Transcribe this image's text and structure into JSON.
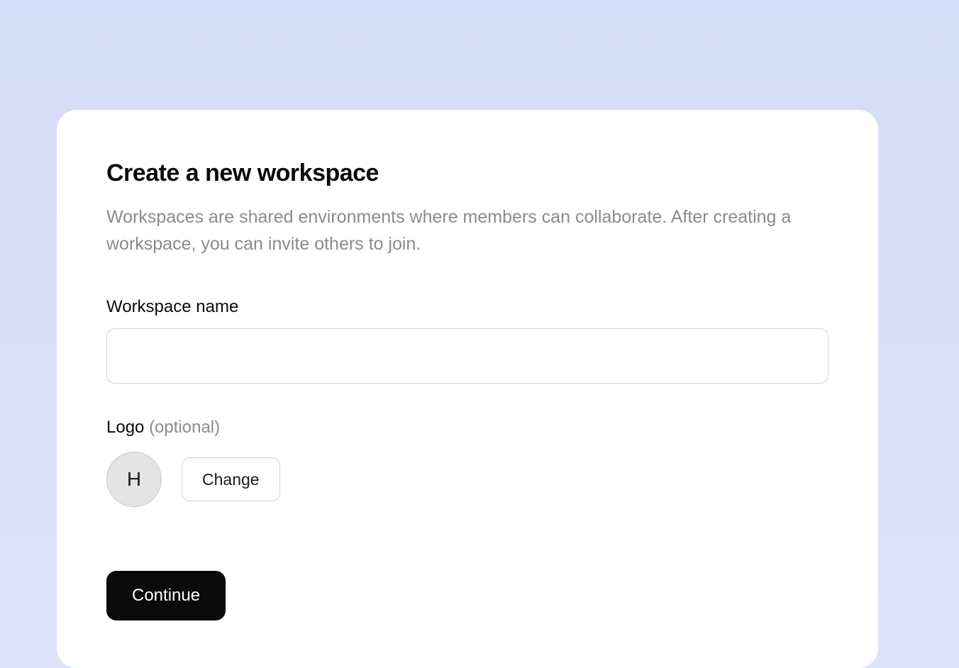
{
  "card": {
    "title": "Create a new workspace",
    "description": "Workspaces are shared environments where members can collaborate. After creating a workspace, you can invite others to join."
  },
  "form": {
    "workspace_name": {
      "label": "Workspace name",
      "value": ""
    },
    "logo": {
      "label": "Logo ",
      "optional_text": "(optional)",
      "avatar_letter": "H",
      "change_button": "Change"
    },
    "continue_button": "Continue"
  }
}
